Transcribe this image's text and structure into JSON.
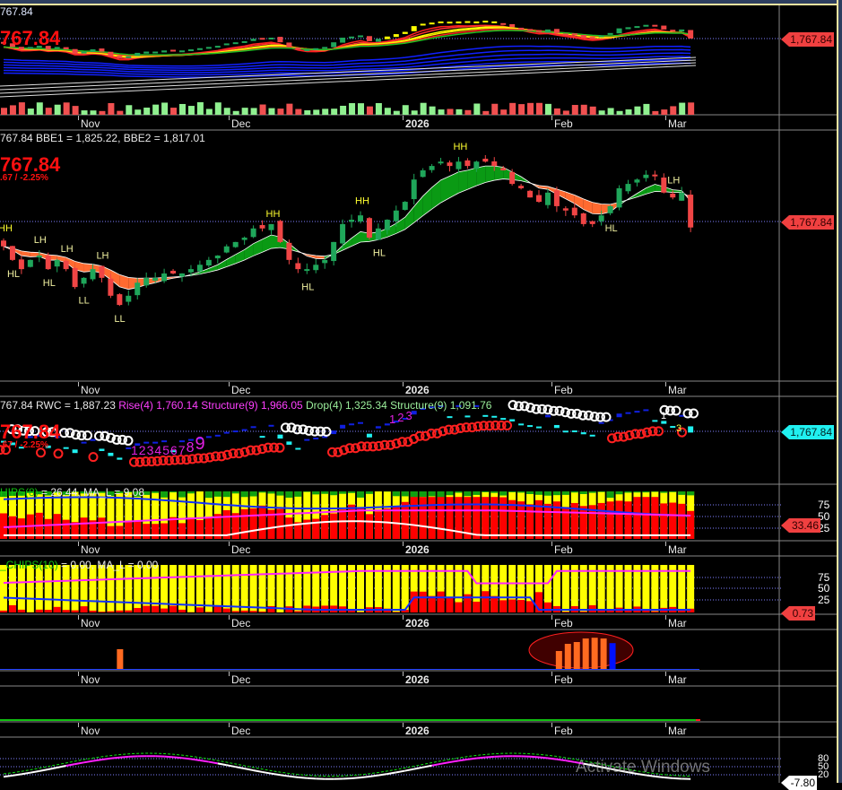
{
  "panes": {
    "price": {
      "header": "767.84",
      "big": "767.84",
      "tag": "1,767.84"
    },
    "bbe": {
      "header": "767.84 BBE1 = 1,825.22, BBE2 = 1,817.01",
      "big": "767.84",
      "change": ".67 / -2.25%",
      "tag": "1,767.84"
    },
    "rwc": {
      "h_price": "767.84 RWC = 1,887.23",
      "h_rise": "Rise(4) 1,760.14 Structure(9) 1,966.05",
      "h_drop": "Drop(4) 1,325.34 Structure(9) 1,091.76",
      "big": "767.84",
      "change": ".67 / -2.25%",
      "tag": "1,767.84",
      "count_a": [
        "1",
        "2",
        "3",
        "4",
        "5",
        "6",
        "7",
        "8",
        "9"
      ],
      "count_b": [
        "1",
        "2",
        "3"
      ],
      "count_c": "1",
      "count_d": "3"
    },
    "chips8": {
      "name": "HIPS(8)",
      "values": " = 26.44, MA_L = 9.08",
      "levels": [
        "75",
        "50",
        "25"
      ],
      "tag": "33.46"
    },
    "chips10": {
      "name": "_CHIPS(10)",
      "values": " = 0.00, MA_L = 0.00",
      "levels": [
        "75",
        "50",
        "25"
      ],
      "tag": "0.73"
    },
    "osc": {
      "levels": [
        "80",
        "50",
        "20"
      ],
      "tag": "-7.80"
    }
  },
  "date_axis": [
    "Nov",
    "Dec",
    "2026",
    "Feb",
    "Mar"
  ],
  "watermark": "Activate Windows",
  "colors": {
    "up": "#1fa65a",
    "down": "#f04545",
    "cloud_up": "#0a9a14",
    "cloud_down": "#ff6a30",
    "accent_red": "#ff1010"
  },
  "chart_data": {
    "type": "candlestick",
    "last_close": 1767.84,
    "ylim": [
      1460,
      1960
    ],
    "closes": [
      1729,
      1701,
      1682,
      1701,
      1710,
      1682,
      1701,
      1682,
      1645,
      1664,
      1682,
      1664,
      1627,
      1608,
      1627,
      1654,
      1664,
      1664,
      1673,
      1673,
      1673,
      1682,
      1691,
      1701,
      1710,
      1729,
      1738,
      1747,
      1766,
      1766,
      1775,
      1738,
      1701,
      1682,
      1682,
      1691,
      1701,
      1738,
      1775,
      1784,
      1793,
      1747,
      1766,
      1784,
      1803,
      1821,
      1867,
      1886,
      1895,
      1904,
      1895,
      1904,
      1895,
      1904,
      1904,
      1895,
      1886,
      1858,
      1849,
      1830,
      1821,
      1840,
      1812,
      1803,
      1793,
      1775,
      1775,
      1793,
      1812,
      1849,
      1858,
      1867,
      1877,
      1877,
      1840,
      1830,
      1840,
      1768
    ],
    "swing_labels": [
      {
        "label": "HH",
        "bar": 0,
        "pos": "above"
      },
      {
        "label": "LH",
        "bar": 4,
        "pos": "above"
      },
      {
        "label": "LH",
        "bar": 7,
        "pos": "above"
      },
      {
        "label": "HL",
        "bar": 1,
        "pos": "below"
      },
      {
        "label": "HL",
        "bar": 5,
        "pos": "below"
      },
      {
        "label": "LL",
        "bar": 9,
        "pos": "below"
      },
      {
        "label": "LH",
        "bar": 11,
        "pos": "above"
      },
      {
        "label": "LL",
        "bar": 13,
        "pos": "below"
      },
      {
        "label": "HH",
        "bar": 30,
        "pos": "above"
      },
      {
        "label": "HL",
        "bar": 34,
        "pos": "below"
      },
      {
        "label": "HH",
        "bar": 40,
        "pos": "above"
      },
      {
        "label": "HL",
        "bar": 42,
        "pos": "below"
      },
      {
        "label": "HH",
        "bar": 51,
        "pos": "above"
      },
      {
        "label": "HL",
        "bar": 68,
        "pos": "below"
      },
      {
        "label": "LH",
        "bar": 75,
        "pos": "above"
      }
    ],
    "signal_bars": [
      {
        "bar": 13,
        "height": 0.55
      },
      {
        "bar": 63,
        "height": 0.5
      },
      {
        "bar": 64,
        "height": 0.7
      },
      {
        "bar": 65,
        "height": 0.75
      },
      {
        "bar": 66,
        "height": 0.85
      },
      {
        "bar": 67,
        "height": 0.87
      },
      {
        "bar": 68,
        "height": 0.85
      },
      {
        "bar": 69,
        "height": 0.72,
        "color": "blue"
      }
    ]
  }
}
